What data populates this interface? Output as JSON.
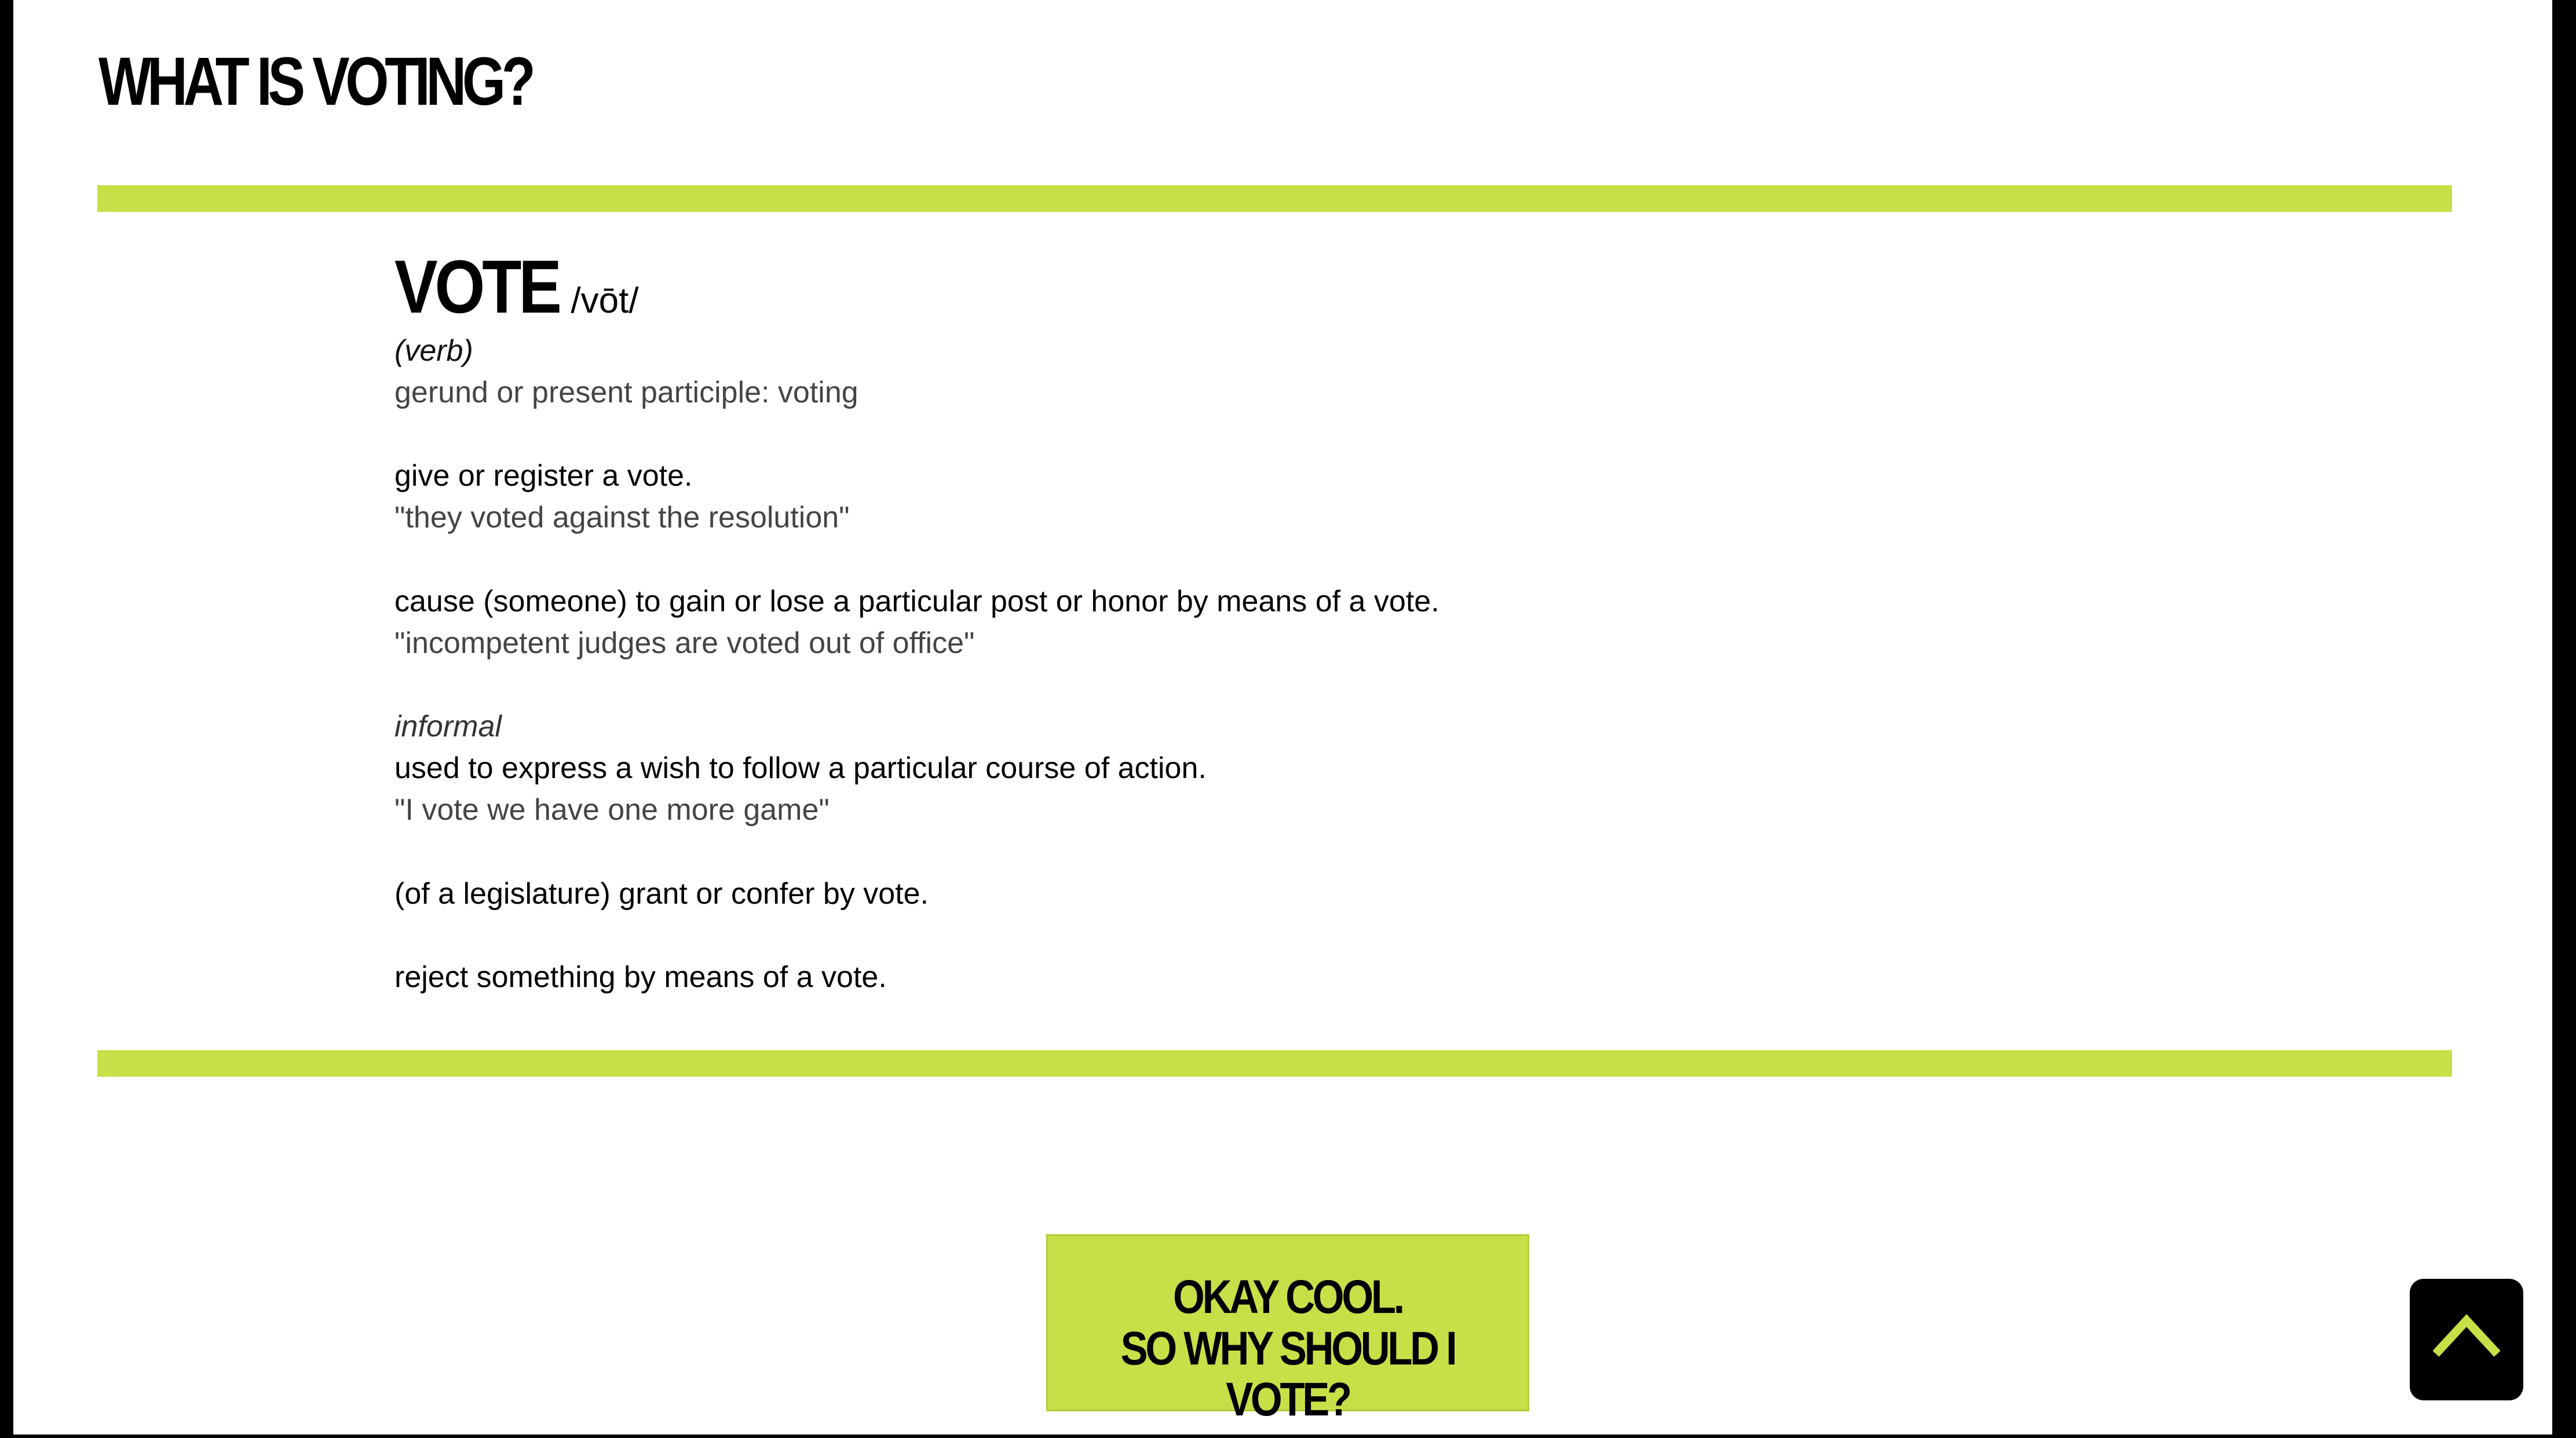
{
  "page": {
    "heading": "WHAT IS VOTING?"
  },
  "definition": {
    "word": "VOTE",
    "pronunciation": "/vōt/",
    "part_of_speech": "(verb)",
    "inflection": "gerund or present participle: voting",
    "senses": [
      {
        "meaning": "give or register a vote.",
        "example": "\"they voted against the resolution\""
      },
      {
        "meaning": "cause (someone) to gain or lose a particular post or honor by means of a vote.",
        "example": "\"incompetent judges are voted out of office\""
      },
      {
        "label": "informal",
        "meaning": "used to express a wish to follow a particular course of action.",
        "example": "\"I vote we have one more game\""
      },
      {
        "meaning": "(of a legislature) grant or confer by vote."
      },
      {
        "meaning": "reject something by means of a vote."
      }
    ]
  },
  "cta": {
    "line1": "OKAY COOL.",
    "line2": "SO WHY SHOULD I VOTE?"
  },
  "scroll_top": {
    "icon": "chevron-up-icon"
  },
  "colors": {
    "accent": "#c9df48",
    "text": "#000000",
    "muted": "#444444",
    "background": "#ffffff"
  }
}
